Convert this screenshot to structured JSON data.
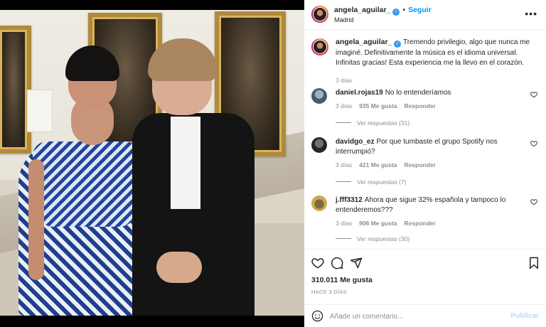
{
  "post": {
    "username": "angela_aguilar_",
    "follow_label": "Seguir",
    "location": "Madrid",
    "separator": "•"
  },
  "caption": {
    "username": "angela_aguilar_",
    "text": "Tremendo privilegio, algo que nunca me imaginé. Definitivamente la música es el idioma universal. Infinitas gracias! Esta experiencia me la llevo en el corazón.",
    "time": "3 días"
  },
  "comments": [
    {
      "username": "daniel.rojas19",
      "text": "No lo entenderíamos",
      "time": "3 días",
      "likes": "935 Me gusta",
      "reply_label": "Responder",
      "replies_label": "Ver respuestas (31)"
    },
    {
      "username": "davidgo_ez",
      "text": "Por que tumbaste el grupo Spotify nos interrumpió?",
      "time": "3 días",
      "likes": "421 Me gusta",
      "reply_label": "Responder",
      "replies_label": "Ver respuestas (7)"
    },
    {
      "username": "j.fff3312",
      "text": "Ahora que sigue 32% española y tampoco lo entenderemos???",
      "time": "3 días",
      "likes": "906 Me gusta",
      "reply_label": "Responder",
      "replies_label": "Ver respuestas (30)"
    }
  ],
  "actions": {
    "likes": "310.011 Me gusta",
    "posted": "HACE 3 DÍAS"
  },
  "add_comment": {
    "placeholder": "Añade un comentario...",
    "publish_label": "Publicar"
  },
  "colors": {
    "accent": "#0095f6",
    "verified": "#3897f0",
    "muted_text": "#8e8e8e",
    "publish_disabled": "#b3dbff"
  },
  "icons": [
    "more-icon",
    "verified-icon",
    "heart-icon",
    "comment-icon",
    "share-icon",
    "bookmark-icon",
    "emoji-icon"
  ]
}
